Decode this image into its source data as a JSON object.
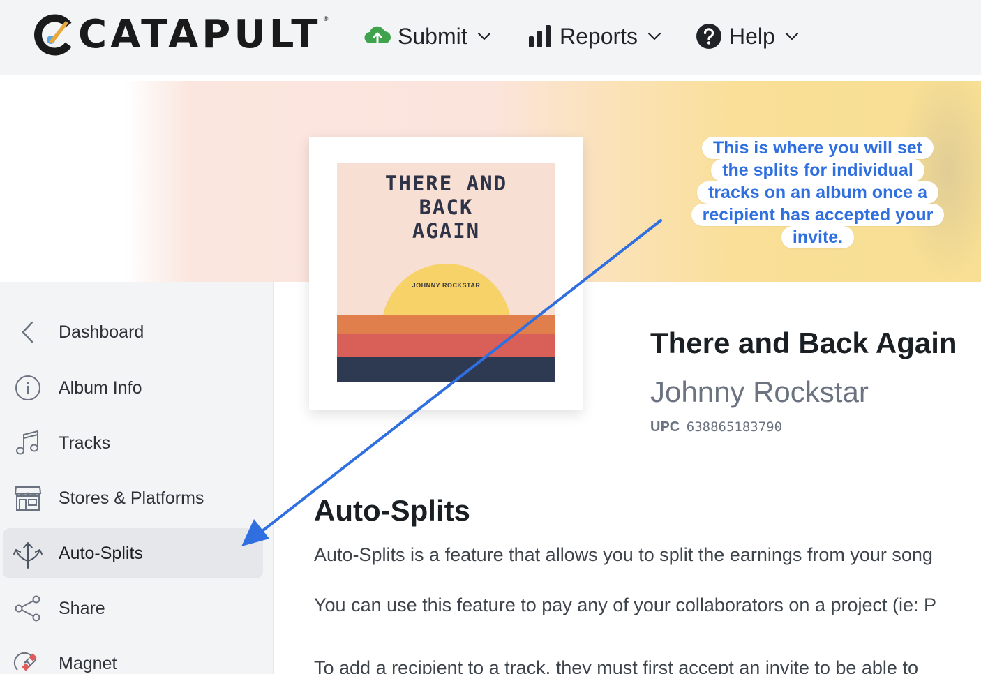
{
  "nav": {
    "logo": "CATAPULT",
    "logo_mark": "®",
    "items": [
      {
        "label": "Submit",
        "icon": "cloud-upload-icon"
      },
      {
        "label": "Reports",
        "icon": "bar-chart-icon"
      },
      {
        "label": "Help",
        "icon": "help-circle-icon"
      }
    ]
  },
  "album_art": {
    "title": "THERE AND\nBACK\nAGAIN",
    "artist": "JOHNNY ROCKSTAR",
    "colors": {
      "background": "#f8dfd3",
      "sun": "#f7d268",
      "stripe1": "#e07f4c",
      "stripe2": "#d95f59",
      "stripe3": "#2e3a52"
    }
  },
  "album": {
    "title": "There and Back Again",
    "artist": "Johnny Rockstar",
    "upc_label": "UPC",
    "upc_value": "638865183790"
  },
  "sidebar": {
    "items": [
      {
        "label": "Dashboard",
        "icon": "chevron-left-icon"
      },
      {
        "label": "Album Info",
        "icon": "info-icon"
      },
      {
        "label": "Tracks",
        "icon": "music-note-icon"
      },
      {
        "label": "Stores & Platforms",
        "icon": "store-icon"
      },
      {
        "label": "Auto-Splits",
        "icon": "split-arrows-icon",
        "active": true
      },
      {
        "label": "Share",
        "icon": "share-icon"
      },
      {
        "label": "Magnet",
        "icon": "magnet-icon"
      }
    ]
  },
  "section": {
    "title": "Auto-Splits",
    "paragraphs": [
      "Auto-Splits is a feature that allows you to split the earnings from your song",
      "You can use this feature to pay any of your collaborators on a project (ie: P",
      "To add a recipient to a track, they must first accept an invite to be able to"
    ]
  },
  "callout": {
    "lines": [
      "This is where you will set",
      "the splits for individual",
      "tracks on an album once a",
      "recipient has accepted your",
      "invite."
    ],
    "color": "#2f6fe0"
  }
}
